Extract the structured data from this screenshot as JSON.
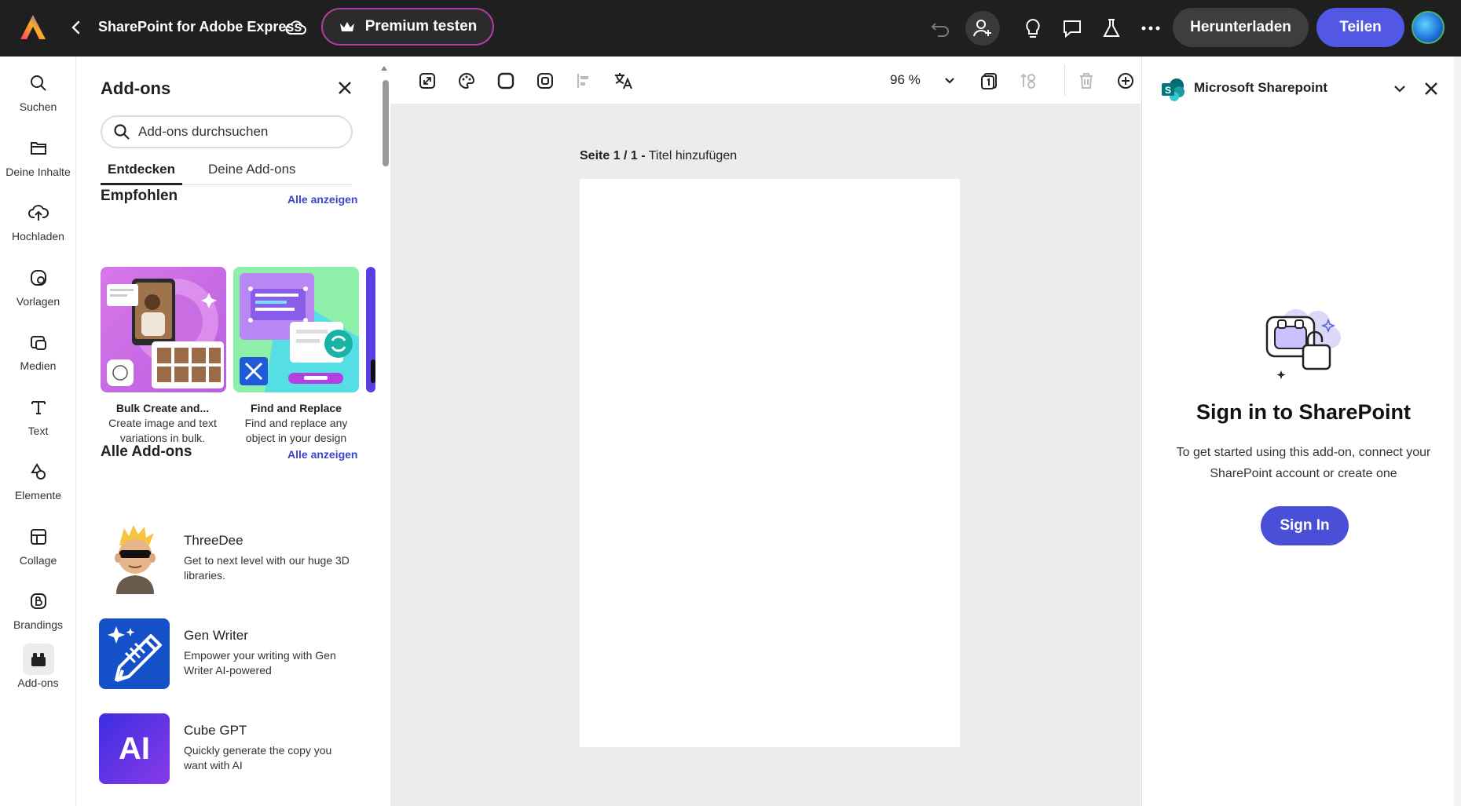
{
  "topbar": {
    "document_title": "SharePoint for Adobe Express",
    "premium_label": "Premium testen",
    "download_label": "Herunterladen",
    "share_label": "Teilen"
  },
  "rail": {
    "items": [
      {
        "label": "Suchen",
        "icon": "search-icon"
      },
      {
        "label": "Deine Inhalte",
        "icon": "folder-icon"
      },
      {
        "label": "Hochladen",
        "icon": "upload-cloud-icon"
      },
      {
        "label": "Vorlagen",
        "icon": "templates-icon"
      },
      {
        "label": "Medien",
        "icon": "media-icon"
      },
      {
        "label": "Text",
        "icon": "text-icon"
      },
      {
        "label": "Elemente",
        "icon": "elements-icon"
      },
      {
        "label": "Collage",
        "icon": "collage-icon"
      },
      {
        "label": "Brandings",
        "icon": "brand-icon"
      },
      {
        "label": "Add-ons",
        "icon": "addons-icon"
      }
    ]
  },
  "addons_panel": {
    "title": "Add-ons",
    "search_placeholder": "Add-ons durchsuchen",
    "tabs": [
      "Entdecken",
      "Deine Add-ons"
    ],
    "recommended": {
      "title": "Empfohlen",
      "see_all": "Alle anzeigen",
      "cards": [
        {
          "name": "Bulk Create and...",
          "desc_line1": "Create image and text",
          "desc_line2": "variations in bulk."
        },
        {
          "name": "Find and Replace",
          "desc_line1": "Find and replace any",
          "desc_line2": "object in your design"
        }
      ]
    },
    "all": {
      "title": "Alle Add-ons",
      "see_all": "Alle anzeigen",
      "items": [
        {
          "name": "ThreeDee",
          "desc": "Get to next level with our huge 3D libraries."
        },
        {
          "name": "Gen Writer",
          "desc": "Empower your writing with Gen Writer AI-powered"
        },
        {
          "name": "Cube GPT",
          "desc": "Quickly generate the copy you want with AI",
          "thumb_text": "AI"
        }
      ]
    }
  },
  "canvas": {
    "zoom": "96 %",
    "page_label_bold": "Seite 1 / 1 -",
    "page_label_rest": " Titel hinzufügen"
  },
  "sharepoint_panel": {
    "title": "Microsoft Sharepoint",
    "heading": "Sign in to SharePoint",
    "description": "To get started using this add-on, connect your SharePoint account or create one",
    "signin_label": "Sign In"
  },
  "colors": {
    "topbar_bg": "#1f1f1f",
    "accent": "#5258e4",
    "premium_border": "#b23aa3",
    "link": "#3a45c8",
    "canvas_bg": "#ececec"
  }
}
